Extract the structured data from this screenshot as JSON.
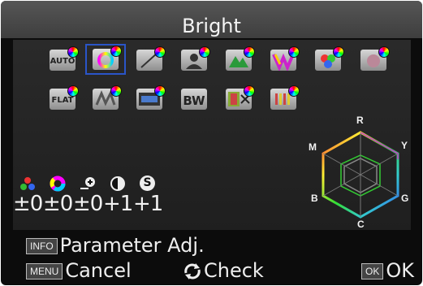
{
  "title": "Bright",
  "tone_presets_row1": [
    "AUTO",
    "",
    "",
    "",
    "",
    "",
    "",
    ""
  ],
  "tone_presets_row2": [
    "FLAT",
    "",
    "",
    "BW",
    "",
    ""
  ],
  "parameters": [
    {
      "icon": "saturation-icon",
      "value": "±0"
    },
    {
      "icon": "hue-icon",
      "value": "±0"
    },
    {
      "icon": "high-low-key-icon",
      "value": "±0"
    },
    {
      "icon": "contrast-icon",
      "value": "+1"
    },
    {
      "icon": "sharpness-icon",
      "value": "+1"
    }
  ],
  "sharpness_symbol": "S",
  "hexagon_labels": {
    "top": "R",
    "top_right": "Y",
    "bottom_right": "G",
    "bottom": "C",
    "bottom_left": "B",
    "top_left": "M"
  },
  "footer": {
    "info_key": "INFO",
    "info_label": "Parameter Adj.",
    "menu_key": "MENU",
    "menu_label": "Cancel",
    "check_label": "Check",
    "ok_key": "OK",
    "ok_label": "OK"
  },
  "colors": {
    "selection": "#2a55c8",
    "screen": "#0c0c0c",
    "text": "#f2f2f2"
  }
}
